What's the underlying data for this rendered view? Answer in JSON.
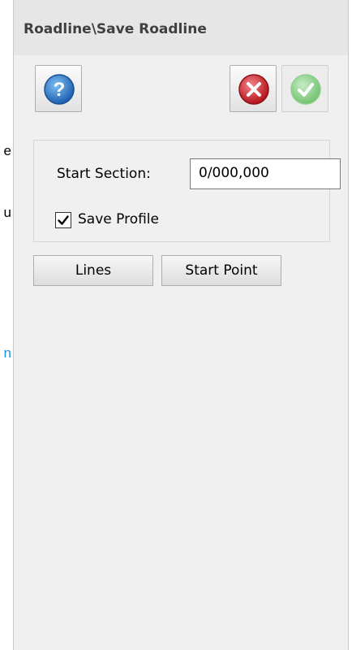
{
  "background_fragments": [
    "e",
    "u",
    "n"
  ],
  "panel": {
    "title": "Roadline\\Save Roadline"
  },
  "toolbar": {
    "help_icon": "help-icon",
    "cancel_icon": "cancel-icon",
    "ok_icon": "check-icon"
  },
  "form": {
    "start_section_label": "Start Section:",
    "start_section_value": "0/000,000",
    "save_profile_label": "Save Profile",
    "save_profile_checked": true
  },
  "buttons": {
    "lines": "Lines",
    "start_point": "Start Point"
  },
  "colors": {
    "help_blue": "#2d7fd0",
    "cancel_red": "#d8282d",
    "ok_green": "#6cc46a",
    "link_blue": "#1e8fe0"
  }
}
